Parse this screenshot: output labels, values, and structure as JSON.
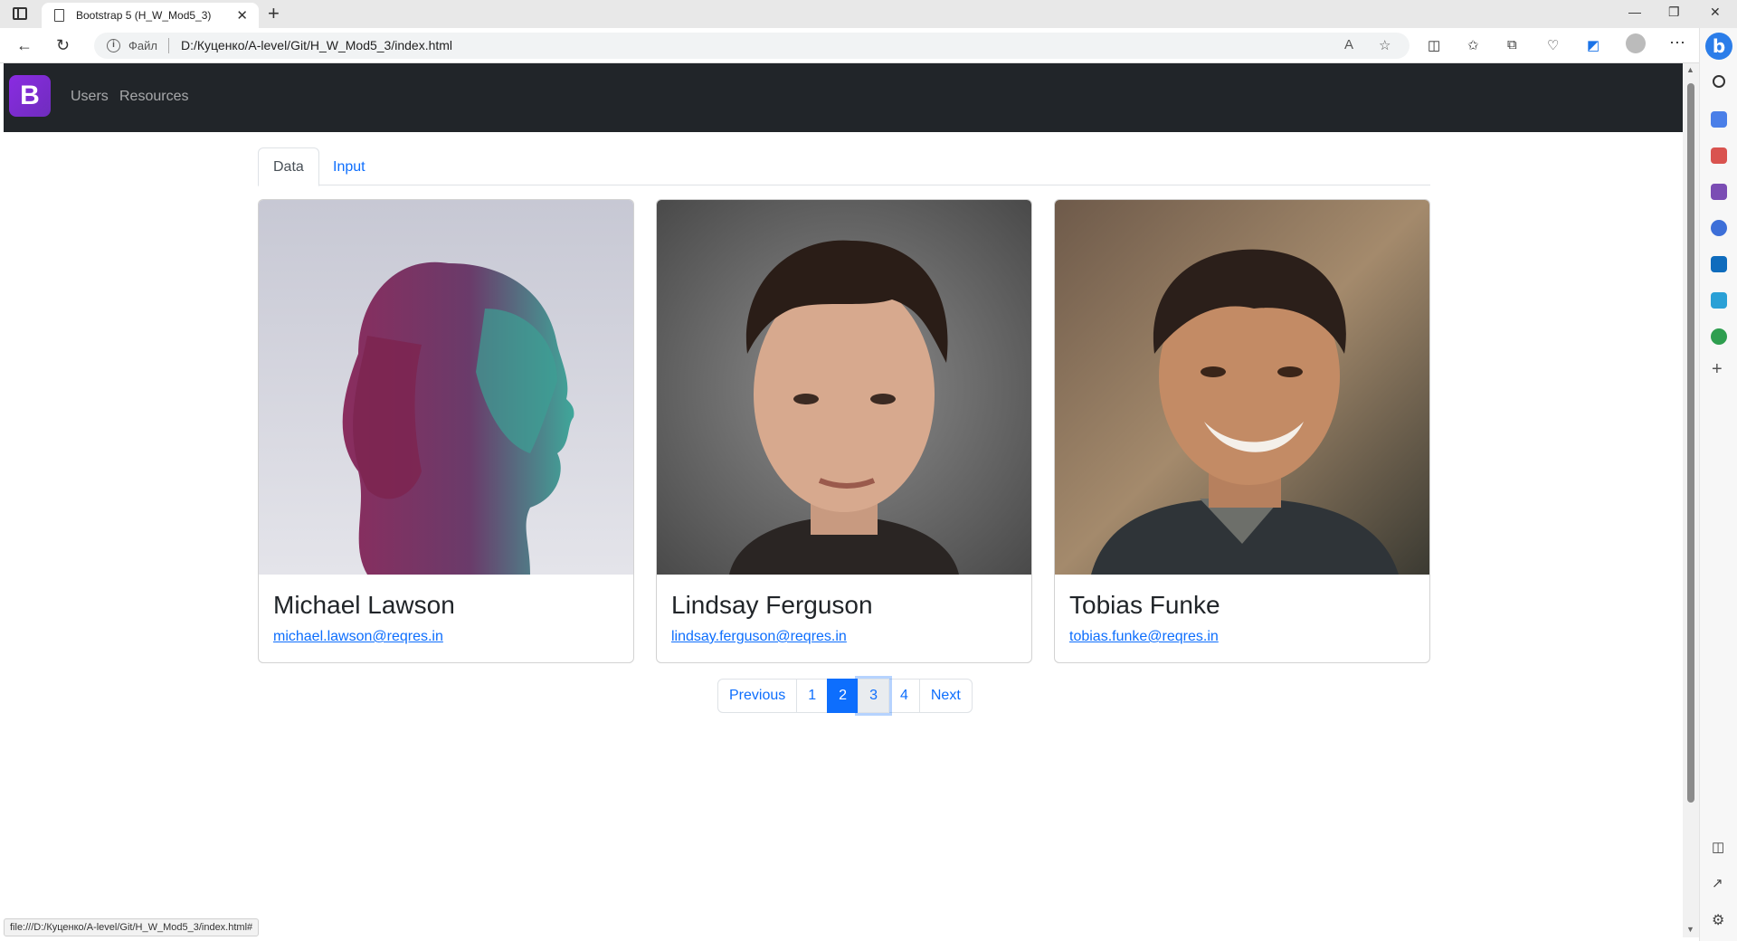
{
  "browser": {
    "tab_title": "Bootstrap 5 (H_W_Mod5_3)",
    "url_scheme_label": "Файл",
    "url": "D:/Куценко/A-level/Git/H_W_Mod5_3/index.html",
    "status_url": "file:///D:/Куценко/A-level/Git/H_W_Mod5_3/index.html#"
  },
  "navbar": {
    "brand": "B",
    "links": [
      "Users",
      "Resources"
    ]
  },
  "tabs": [
    "Data",
    "Input"
  ],
  "users": [
    {
      "name": "Michael Lawson",
      "email": "michael.lawson@reqres.in"
    },
    {
      "name": "Lindsay Ferguson",
      "email": "lindsay.ferguson@reqres.in"
    },
    {
      "name": "Tobias Funke",
      "email": "tobias.funke@reqres.in"
    }
  ],
  "pagination": {
    "previous": "Previous",
    "pages": [
      "1",
      "2",
      "3",
      "4"
    ],
    "active_page": "2",
    "next": "Next"
  },
  "colors": {
    "primary": "#0d6efd",
    "navbar_bg": "#212529",
    "brand": "#7952b3"
  }
}
